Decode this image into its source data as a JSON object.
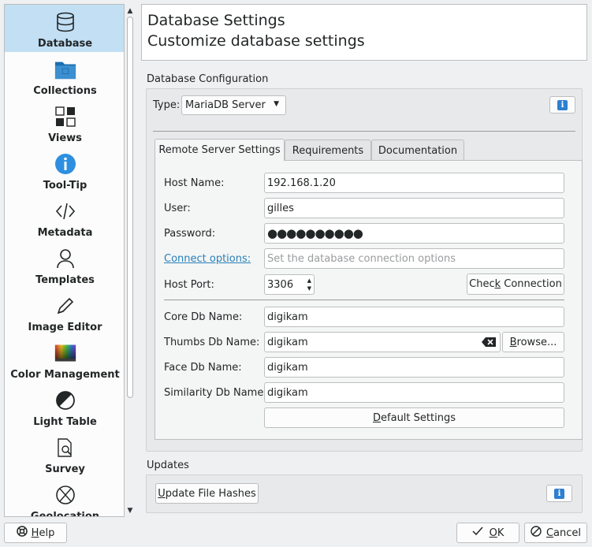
{
  "sidebar": {
    "items": [
      {
        "label": "Database",
        "icon": "database-icon",
        "selected": true
      },
      {
        "label": "Collections",
        "icon": "folder-icon"
      },
      {
        "label": "Views",
        "icon": "views-grid-icon"
      },
      {
        "label": "Tool-Tip",
        "icon": "info-icon"
      },
      {
        "label": "Metadata",
        "icon": "code-icon"
      },
      {
        "label": "Templates",
        "icon": "user-icon"
      },
      {
        "label": "Image Editor",
        "icon": "pencil-icon"
      },
      {
        "label": "Color Management",
        "icon": "color-gradient-icon"
      },
      {
        "label": "Light Table",
        "icon": "half-circle-icon"
      },
      {
        "label": "Survey",
        "icon": "document-search-icon"
      },
      {
        "label": "Geolocation",
        "icon": "globe-icon"
      }
    ]
  },
  "header": {
    "title": "Database Settings",
    "subtitle": "Customize database settings"
  },
  "db_config": {
    "group_title": "Database Configuration",
    "type_label": "Type:",
    "type_value": "MariaDB Server",
    "tabs": [
      "Remote Server Settings",
      "Requirements",
      "Documentation"
    ],
    "host_label": "Host Name:",
    "host_value": "192.168.1.20",
    "user_label": "User:",
    "user_value": "gilles",
    "password_label": "Password:",
    "password_value": "●●●●●●●●●●",
    "connect_label": "Connect options:",
    "connect_placeholder": "Set the database connection options",
    "port_label": "Host Port:",
    "port_value": "3306",
    "check_btn_pre": "Chec",
    "check_btn_u": "k",
    "check_btn_post": " Connection",
    "core_label": "Core Db Name:",
    "core_value": "digikam",
    "thumbs_label": "Thumbs Db Name:",
    "thumbs_value": "digikam",
    "browse_pre": "",
    "browse_u": "B",
    "browse_post": "rowse...",
    "face_label": "Face Db Name:",
    "face_value": "digikam",
    "similarity_label": "Similarity Db Name:",
    "similarity_value": "digikam",
    "default_u": "D",
    "default_post": "efault Settings"
  },
  "updates": {
    "group_title": "Updates",
    "update_u": "U",
    "update_post": "pdate File Hashes"
  },
  "footer": {
    "help_u": "H",
    "help_post": "elp",
    "ok_u": "O",
    "ok_post": "K",
    "cancel_u": "C",
    "cancel_post": "ancel"
  },
  "colors": {
    "selection": "#c2dff4",
    "link": "#2980b9",
    "info": "#2e7fd0"
  }
}
